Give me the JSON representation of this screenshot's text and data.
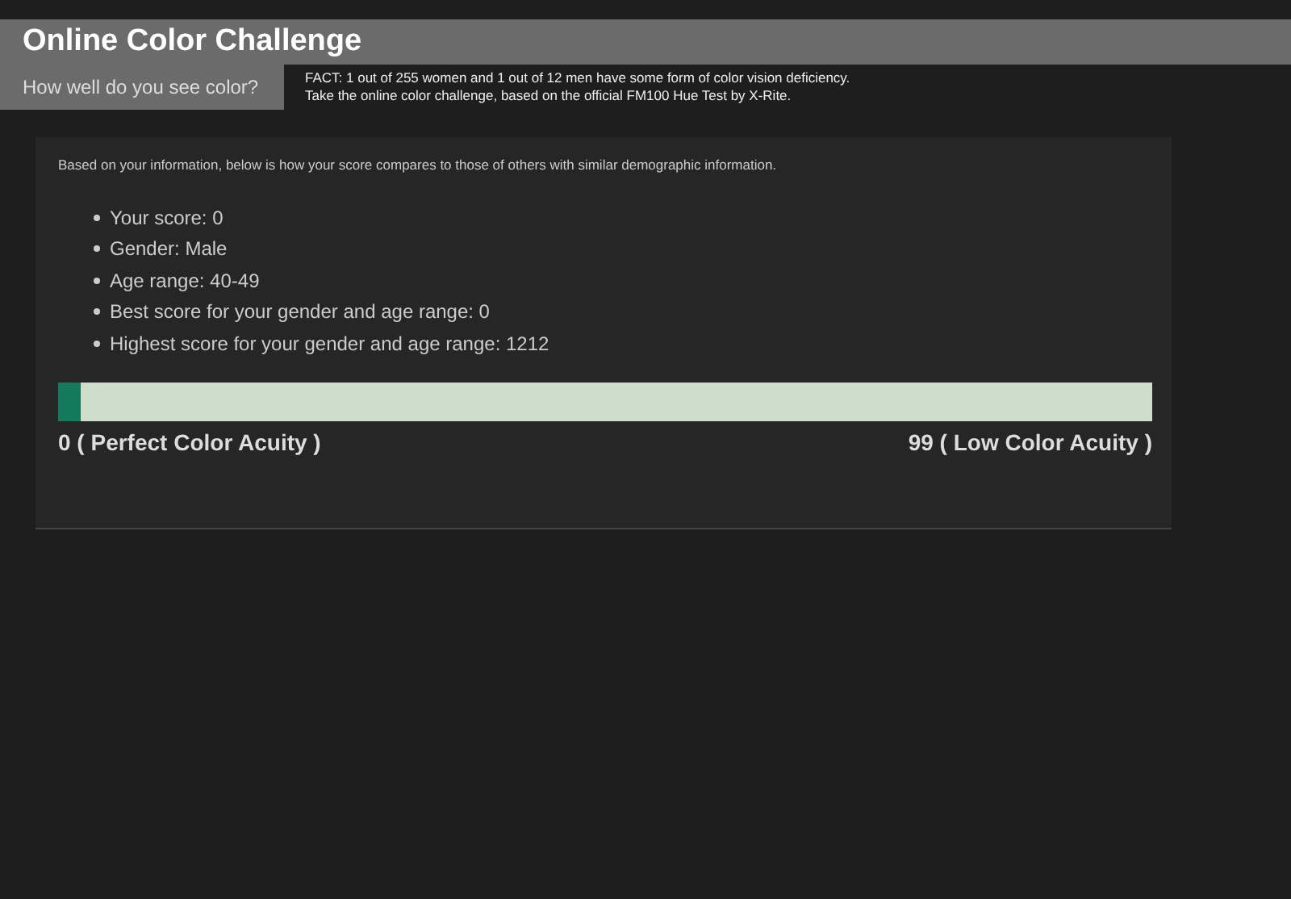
{
  "header": {
    "title": "Online Color Challenge",
    "subtitle": "How well do you see color?",
    "fact_lines": [
      "FACT: 1 out of 255 women and 1 out of 12 men have some form of color vision deficiency.",
      "Take the online color challenge, based on the official FM100 Hue Test by X-Rite."
    ]
  },
  "results": {
    "intro": "Based on your information, below is how your score compares to those of others with similar demographic information.",
    "items": [
      "Your score: 0",
      "Gender: Male",
      "Age range: 40-49",
      "Best score for your gender and age range: 0",
      "Highest score for your gender and age range: 1212"
    ],
    "score_bar": {
      "level": 0.02,
      "min_label": "0 ( Perfect Color Acuity )",
      "max_label": "99 ( Low Color Acuity )"
    }
  }
}
